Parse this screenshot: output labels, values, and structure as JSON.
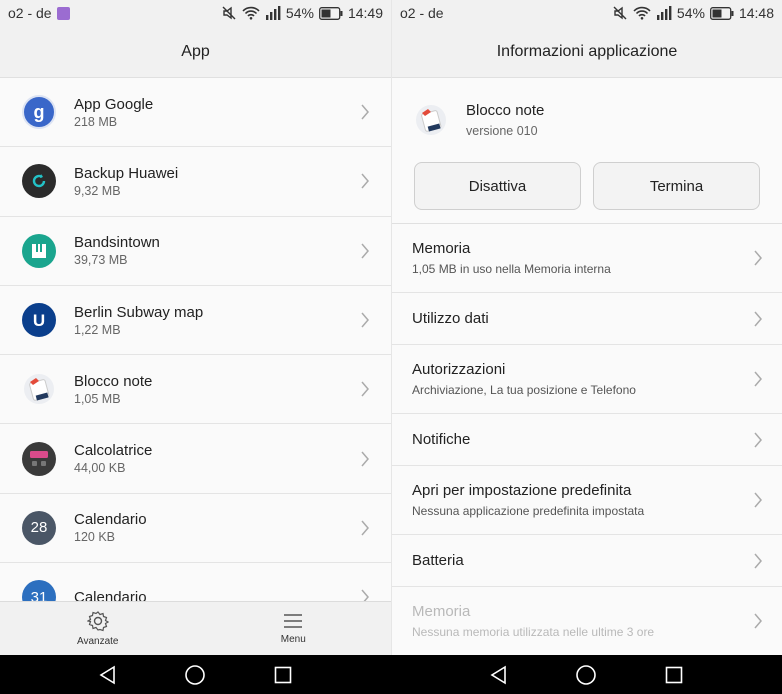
{
  "left": {
    "status": {
      "carrier": "o2 - de",
      "battery": "54%",
      "time": "14:49"
    },
    "title": "App",
    "apps": [
      {
        "name": "App Google",
        "size": "218 MB",
        "icon": "google-icon"
      },
      {
        "name": "Backup Huawei",
        "size": "9,32 MB",
        "icon": "backup-icon"
      },
      {
        "name": "Bandsintown",
        "size": "39,73 MB",
        "icon": "bandsintown-icon"
      },
      {
        "name": "Berlin Subway map",
        "size": "1,22 MB",
        "icon": "subway-icon"
      },
      {
        "name": "Blocco note",
        "size": "1,05 MB",
        "icon": "notepad-icon"
      },
      {
        "name": "Calcolatrice",
        "size": "44,00 KB",
        "icon": "calculator-icon"
      },
      {
        "name": "Calendario",
        "size": "120 KB",
        "icon": "calendar-icon",
        "icon_text": "28"
      },
      {
        "name": "Calendario",
        "size": "",
        "icon": "calendar-blue-icon",
        "icon_text": "31"
      }
    ],
    "tools": {
      "advanced": "Avanzate",
      "menu": "Menu"
    }
  },
  "right": {
    "status": {
      "carrier": "o2 - de",
      "battery": "54%",
      "time": "14:48"
    },
    "title": "Informazioni applicazione",
    "app": {
      "name": "Blocco note",
      "version": "versione 010"
    },
    "buttons": {
      "disable": "Disattiva",
      "stop": "Termina"
    },
    "settings": [
      {
        "title": "Memoria",
        "subtitle": "1,05 MB in uso nella Memoria interna"
      },
      {
        "title": "Utilizzo dati",
        "subtitle": ""
      },
      {
        "title": "Autorizzazioni",
        "subtitle": "Archiviazione, La tua posizione e Telefono"
      },
      {
        "title": "Notifiche",
        "subtitle": ""
      },
      {
        "title": "Apri per impostazione predefinita",
        "subtitle": "Nessuna applicazione predefinita impostata"
      },
      {
        "title": "Batteria",
        "subtitle": ""
      },
      {
        "title": "Memoria",
        "subtitle": "Nessuna memoria utilizzata nelle ultime 3 ore",
        "disabled": true
      }
    ]
  },
  "colors": {
    "accent_google": "#3a67c9",
    "subway_blue": "#0b3f8c",
    "bandsintown_green": "#1aa58e"
  }
}
